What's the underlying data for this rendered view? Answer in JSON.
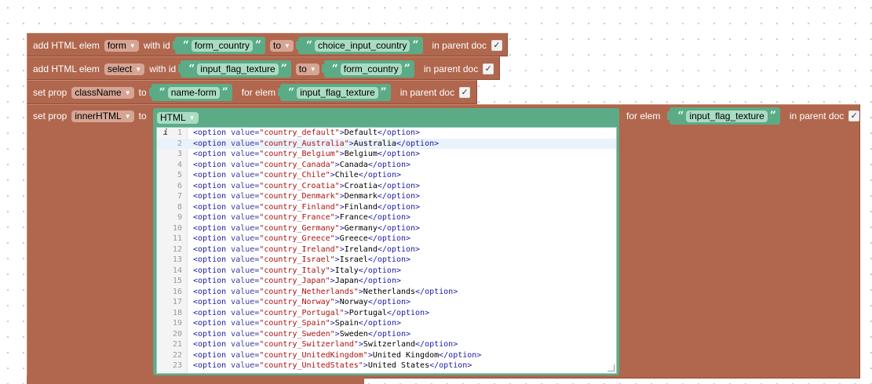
{
  "blocks": {
    "row1": {
      "text1": "add HTML elem",
      "dropdown": "form",
      "text2": "with id",
      "id_value": "form_country",
      "to_dropdown": "to",
      "target_value": "choice_input_country",
      "text3": "in parent doc",
      "check": "✓"
    },
    "row2": {
      "text1": "add HTML elem",
      "dropdown": "select",
      "text2": "with id",
      "id_value": "input_flag_texture",
      "to_dropdown": "to",
      "target_value": "form_country",
      "text3": "in parent doc",
      "check": "✓"
    },
    "row3": {
      "text1": "set prop",
      "dropdown": "className",
      "text2": "to",
      "value": "name-form",
      "text3": "for elem",
      "elem_value": "input_flag_texture",
      "text4": "in parent doc",
      "check": "✓"
    },
    "row4": {
      "text1": "set prop",
      "dropdown": "innerHTML",
      "text2": "to",
      "html_dropdown": "HTML",
      "text3": "for elem",
      "elem_value": "input_flag_texture",
      "text4": "in parent doc",
      "check": "✓"
    }
  },
  "editor": {
    "info_marker": "i",
    "lines": [
      {
        "num": "1",
        "value": "country_default",
        "label": "Default"
      },
      {
        "num": "2",
        "value": "country_Australia",
        "label": "Australia"
      },
      {
        "num": "3",
        "value": "country_Belgium",
        "label": "Belgium"
      },
      {
        "num": "4",
        "value": "country_Canada",
        "label": "Canada"
      },
      {
        "num": "5",
        "value": "country_Chile",
        "label": "Chile"
      },
      {
        "num": "6",
        "value": "country_Croatia",
        "label": "Croatia"
      },
      {
        "num": "7",
        "value": "country_Denmark",
        "label": "Denmark"
      },
      {
        "num": "8",
        "value": "country_Finland",
        "label": "Finland"
      },
      {
        "num": "9",
        "value": "country_France",
        "label": "France"
      },
      {
        "num": "10",
        "value": "country_Germany",
        "label": "Germany"
      },
      {
        "num": "11",
        "value": "country_Greece",
        "label": "Greece"
      },
      {
        "num": "12",
        "value": "country_Ireland",
        "label": "Ireland"
      },
      {
        "num": "13",
        "value": "country_Israel",
        "label": "Israel"
      },
      {
        "num": "14",
        "value": "country_Italy",
        "label": "Italy"
      },
      {
        "num": "15",
        "value": "country_Japan",
        "label": "Japan"
      },
      {
        "num": "16",
        "value": "country_Netherlands",
        "label": "Netherlands"
      },
      {
        "num": "17",
        "value": "country_Norway",
        "label": "Norway"
      },
      {
        "num": "18",
        "value": "country_Portugal",
        "label": "Portugal"
      },
      {
        "num": "19",
        "value": "country_Spain",
        "label": "Spain"
      },
      {
        "num": "20",
        "value": "country_Sweden",
        "label": "Sweden"
      },
      {
        "num": "21",
        "value": "country_Switzerland",
        "label": "Switzerland"
      },
      {
        "num": "22",
        "value": "country_UnitedKingdom",
        "label": "United Kingdom"
      },
      {
        "num": "23",
        "value": "country_UnitedStates",
        "label": "United States"
      }
    ],
    "syntax": {
      "open_tag": "<option",
      "attr": " value=",
      "close_open": ">",
      "close_tag": "</option>"
    }
  },
  "colors": {
    "block": "#b0674e",
    "string_block": "#5bac86",
    "string_value": "#a9dcc2",
    "dropdown": "#d6a595"
  }
}
